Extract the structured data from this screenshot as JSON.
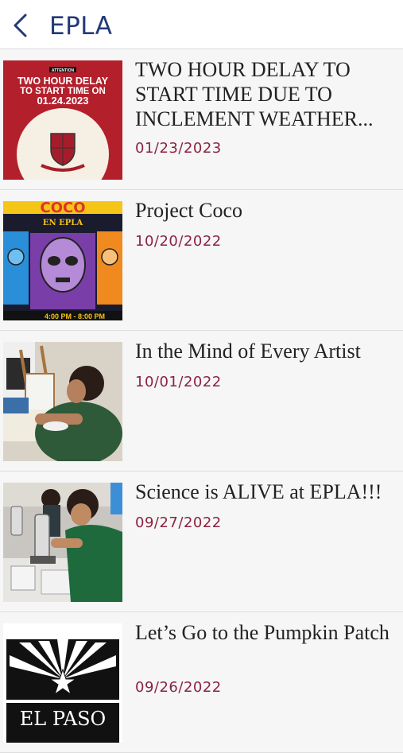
{
  "header": {
    "title": "EPLA",
    "back_icon": "chevron-left-icon",
    "accent": "#233a78"
  },
  "date_color": "#8a2340",
  "items": [
    {
      "title": "TWO HOUR DELAY TO START TIME DUE TO INCLEMENT WEATHER...",
      "date": "01/23/2023",
      "thumb": {
        "kind": "flyer",
        "attention": "ATTENTION",
        "line1": "TWO HOUR DELAY",
        "line2": "TO START TIME ON",
        "line3": "01.24.2023"
      }
    },
    {
      "title": "Project Coco",
      "date": "10/20/2022",
      "thumb": {
        "kind": "poster",
        "top": "COCO",
        "sub": "EN EPLA",
        "bottom": "4:00 PM - 8:00 PM"
      }
    },
    {
      "title": "In the Mind of Every Artist",
      "date": "10/01/2022",
      "thumb": {
        "kind": "photo-art"
      }
    },
    {
      "title": "Science is ALIVE at EPLA!!!",
      "date": "09/27/2022",
      "thumb": {
        "kind": "photo-science"
      }
    },
    {
      "title": "Let’s Go to the Pumpkin Patch",
      "date": "09/26/2022",
      "thumb": {
        "kind": "logo",
        "text": "EL PASO"
      }
    }
  ]
}
